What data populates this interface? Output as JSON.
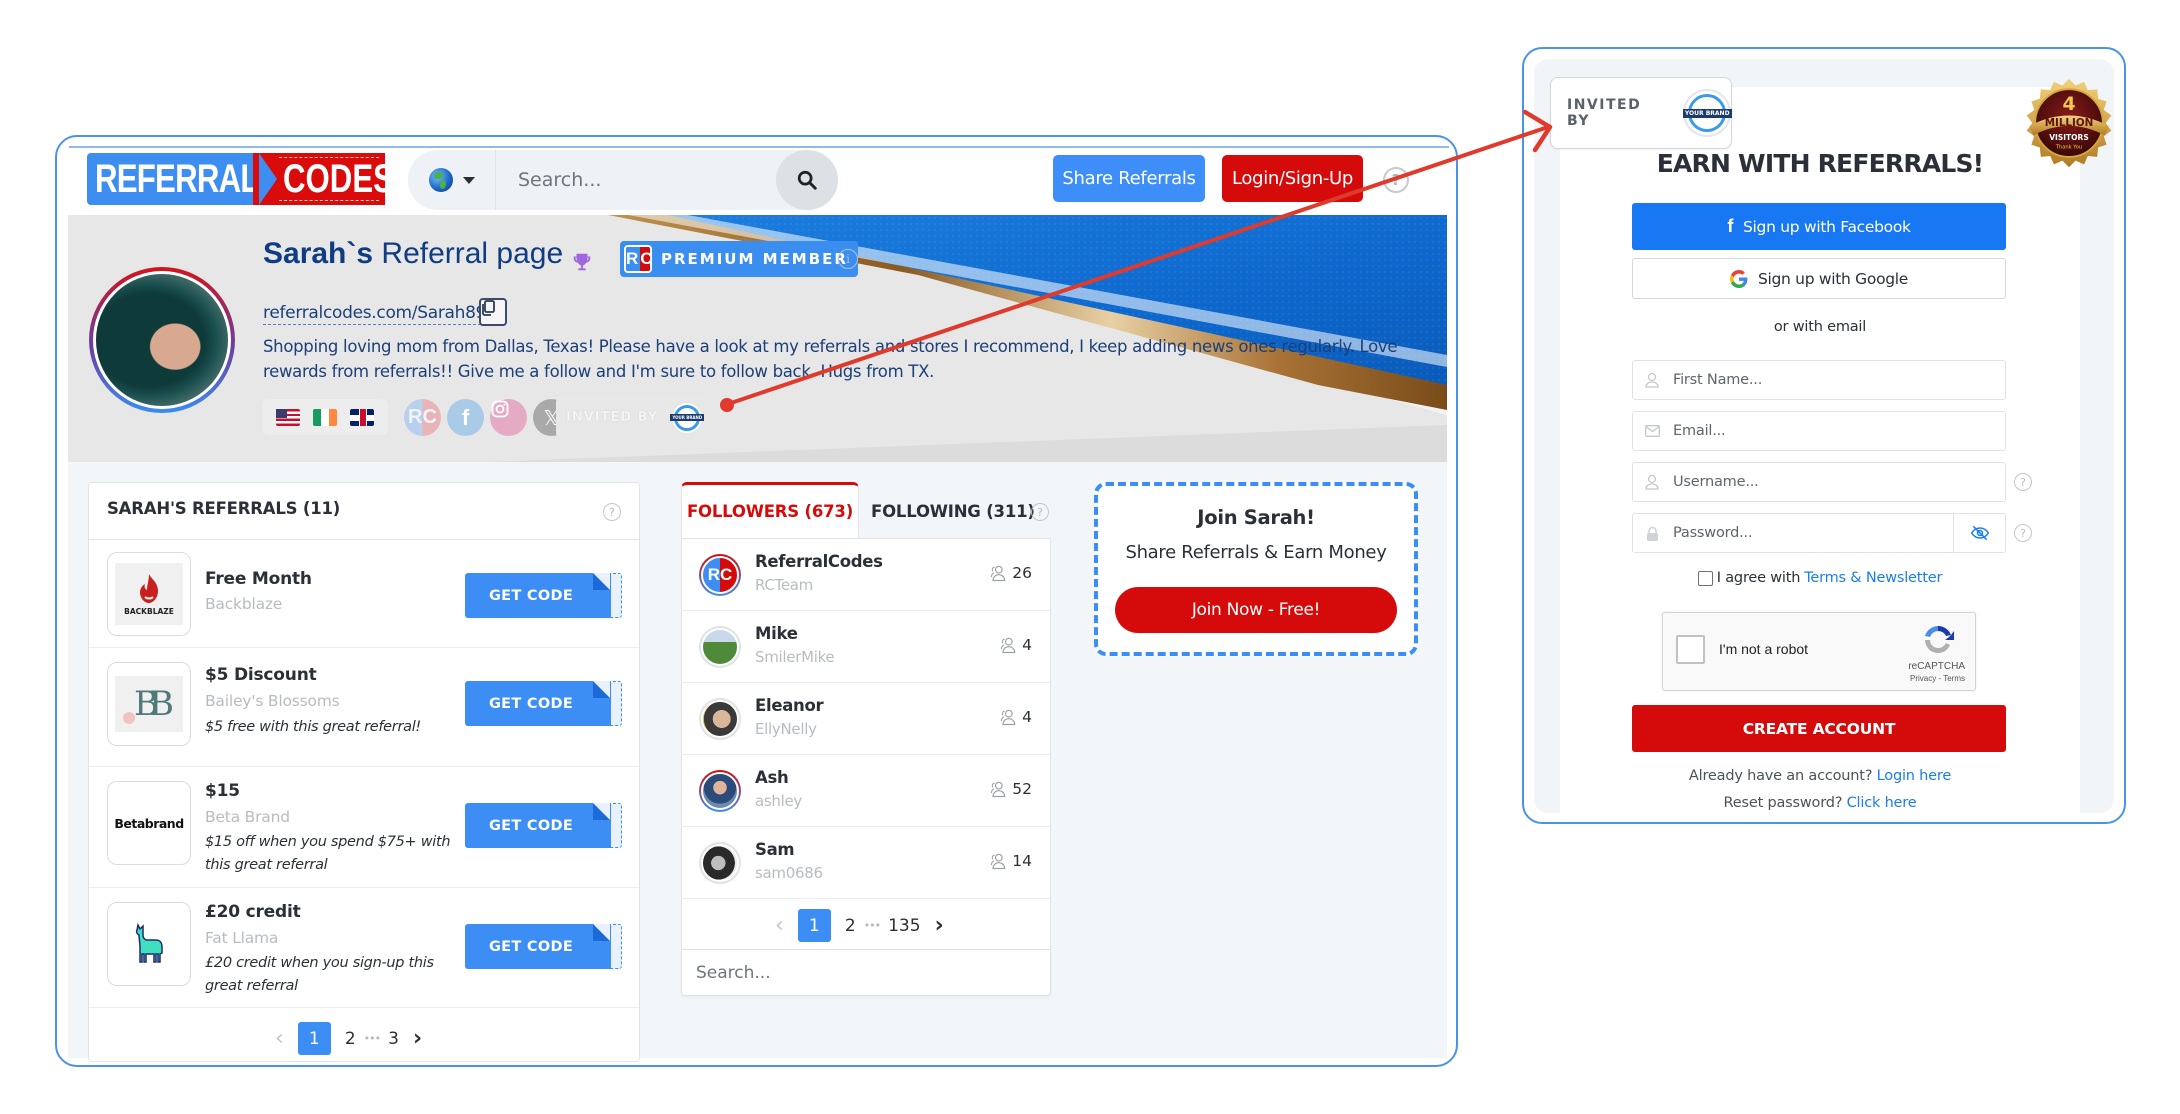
{
  "header": {
    "logo_left": "REFERRAL",
    "logo_right": "CODES",
    "search_placeholder": "Search...",
    "share_button": "Share Referrals",
    "login_button": "Login/Sign-Up",
    "help": "?"
  },
  "profile": {
    "title_bold": "Sarah`s",
    "title_rest": " Referral page",
    "premium_badge": "PREMIUM MEMBER",
    "rc_left": "R",
    "rc_right": "C",
    "info_icon": "i",
    "url": "referralcodes.com/Sarah89",
    "bio": "Shopping loving mom from Dallas, Texas! Please have a look at my referrals and stores I recommend, I keep adding news ones regularly. Love rewards from referrals!! Give me a follow and I'm sure to follow back. Hugs from TX.",
    "flags": [
      "us-flag",
      "ireland-flag",
      "uk-flag"
    ],
    "social": {
      "rc": "RC",
      "facebook": "f",
      "x": "𝕏"
    },
    "invited_by_label": "INVITED BY",
    "brand_logo_text": "YOUR BRAND"
  },
  "referrals": {
    "title": "SARAH'S REFERRALS (11)",
    "get_code_label": "GET CODE",
    "items": [
      {
        "title": "Free Month",
        "store": "Backblaze",
        "description": "",
        "logo_text": "BACKBLAZE"
      },
      {
        "title": "$5 Discount",
        "store": "Bailey's Blossoms",
        "description": "$5 free with this great referral!",
        "logo_text": "BB"
      },
      {
        "title": "$15",
        "store": "Beta Brand",
        "description": "$15 off when you spend $75+ with this great referral",
        "logo_text": "Betabrand"
      },
      {
        "title": "£20 credit",
        "store": "Fat Llama",
        "description": "£20 credit when you sign-up this great referral",
        "logo_text": ""
      }
    ],
    "pager": {
      "prev": "‹",
      "current": "1",
      "pages": [
        "2",
        "3"
      ],
      "dots": "•••",
      "next": "›"
    }
  },
  "followers": {
    "tab_followers": "FOLLOWERS (673)",
    "tab_following": "FOLLOWING (311)",
    "items": [
      {
        "name": "ReferralCodes",
        "username": "RCTeam",
        "count": "26"
      },
      {
        "name": "Mike",
        "username": "SmilerMike",
        "count": "4"
      },
      {
        "name": "Eleanor",
        "username": "EllyNelly",
        "count": "4"
      },
      {
        "name": "Ash",
        "username": "ashley",
        "count": "52"
      },
      {
        "name": "Sam",
        "username": "sam0686",
        "count": "14"
      }
    ],
    "pager": {
      "prev": "‹",
      "current": "1",
      "pages": [
        "2",
        "135"
      ],
      "dots": "•••",
      "next": "›"
    },
    "search_placeholder": "Search..."
  },
  "join": {
    "title": "Join Sarah!",
    "subtitle": "Share Referrals & Earn Money",
    "button": "Join Now - Free!"
  },
  "signup": {
    "invited_by_label": "INVITED BY",
    "brand_logo_text": "YOUR BRAND",
    "badge": {
      "number": "4",
      "million": "MILLION",
      "visitors": "VISITORS",
      "thanks": "Thank You"
    },
    "title": "EARN WITH REFERRALS!",
    "facebook_button": "Sign up with Facebook",
    "google_button": "Sign up with Google",
    "or_email": "or with email",
    "first_name_placeholder": "First Name...",
    "email_placeholder": "Email...",
    "username_placeholder": "Username...",
    "password_placeholder": "Password...",
    "agree_prefix": "I agree with ",
    "agree_link": "Terms & Newsletter",
    "recaptcha_label": "I'm not a robot",
    "recaptcha_brand": "reCAPTCHA",
    "recaptcha_links": "Privacy - Terms",
    "create_button": "CREATE ACCOUNT",
    "already_prefix": "Already have an account? ",
    "login_link": "Login here",
    "reset_prefix": "Reset password? ",
    "reset_link": "Click here"
  },
  "colors": {
    "brand_blue": "#3c8ef5",
    "brand_red": "#d50b0b",
    "frame_blue": "#4a93e6",
    "arrow_red": "#e03a2c",
    "title_navy": "#0f3c82"
  }
}
